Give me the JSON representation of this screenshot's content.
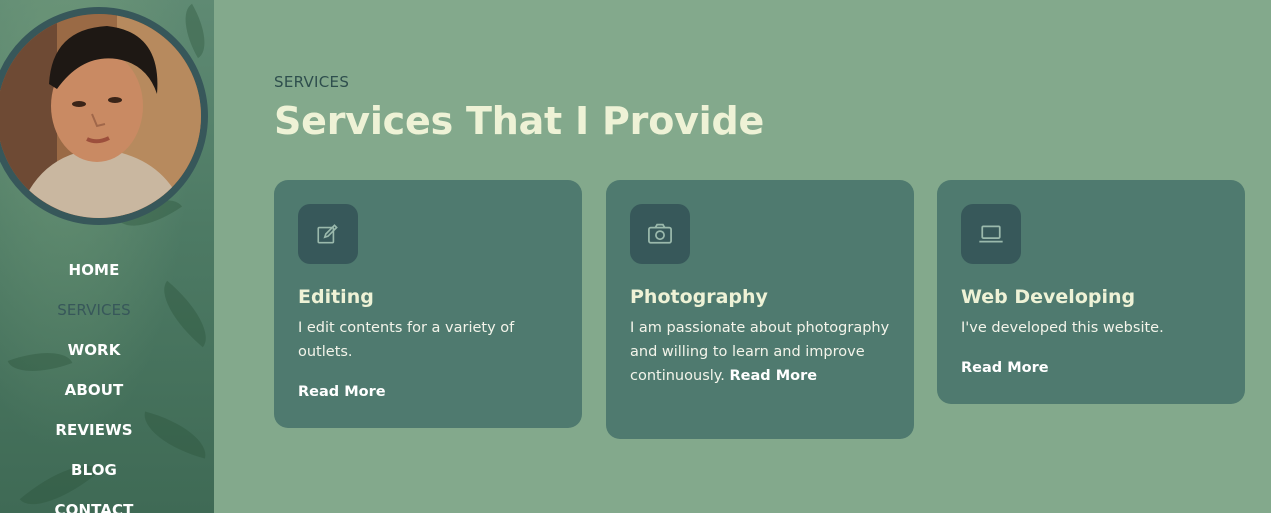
{
  "sidebar": {
    "avatar_alt": "profile photo",
    "nav": [
      {
        "label": "HOME"
      },
      {
        "label": "SERVICES"
      },
      {
        "label": "WORK"
      },
      {
        "label": "ABOUT"
      },
      {
        "label": "REVIEWS"
      },
      {
        "label": "BLOG"
      },
      {
        "label": "CONTACT"
      }
    ]
  },
  "services": {
    "eyebrow": "SERVICES",
    "title": "Services That I Provide",
    "cards": [
      {
        "icon": "edit-icon",
        "title": "Editing",
        "text": "I edit contents for a variety of outlets.",
        "read_more": "Read More"
      },
      {
        "icon": "camera-icon",
        "title": "Photography",
        "text": "I am passionate about photography and willing to learn and improve continuously.",
        "read_more": "Read More"
      },
      {
        "icon": "laptop-icon",
        "title": "Web Developing",
        "text": "I've developed this website.",
        "read_more": "Read More"
      }
    ]
  },
  "colors": {
    "background": "#83a98c",
    "card": "#4f7a6f",
    "icon_box": "#37585a",
    "title": "#eef2d6",
    "active_nav": "#37575a"
  }
}
